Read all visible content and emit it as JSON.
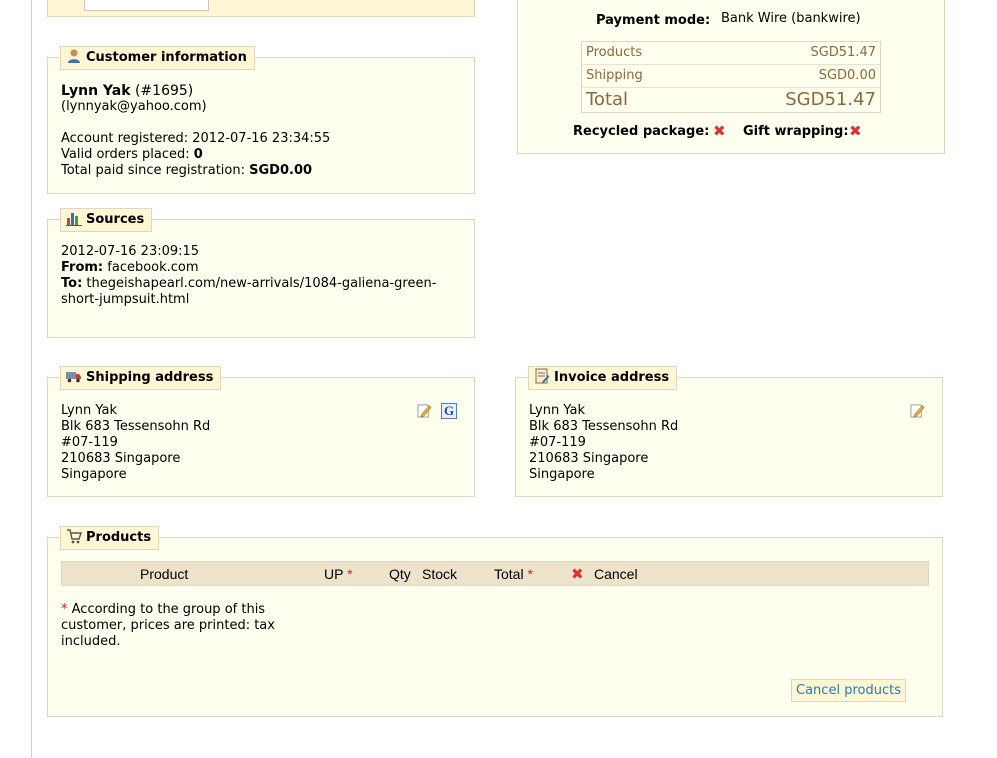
{
  "payment": {
    "mode_label": "Payment mode:",
    "mode_value": "Bank Wire (bankwire)",
    "rows": [
      {
        "label": "Products",
        "value": "SGD51.47"
      },
      {
        "label": "Shipping",
        "value": "SGD0.00"
      },
      {
        "label": "Total",
        "value": "SGD51.47"
      }
    ],
    "recycled_label": "Recycled package:",
    "gift_label": "Gift wrapping:"
  },
  "customer": {
    "legend": "Customer information",
    "name": "Lynn Yak",
    "id": "(#1695)",
    "email": "(lynnyak@yahoo.com)",
    "registered_label": "Account registered:",
    "registered_value": "2012-07-16 23:34:55",
    "orders_label": "Valid orders placed:",
    "orders_value": "0",
    "paid_label": "Total paid since registration:",
    "paid_value": "SGD0.00"
  },
  "sources": {
    "legend": "Sources",
    "date": "2012-07-16 23:09:15",
    "from_label": "From:",
    "from_value": "facebook.com",
    "to_label": "To:",
    "to_value_line1": "thegeishapearl.com/new-arrivals/1084-galiena-green-",
    "to_value_line2": "short-jumpsuit.html"
  },
  "shipping_address": {
    "legend": "Shipping address",
    "lines": [
      "Lynn Yak",
      "Blk 683 Tessensohn Rd",
      "#07-119",
      "210683 Singapore",
      "Singapore"
    ],
    "g_icon_text": "G"
  },
  "invoice_address": {
    "legend": "Invoice address",
    "lines": [
      "Lynn Yak",
      "Blk 683 Tessensohn Rd",
      "#07-119",
      "210683 Singapore",
      "Singapore"
    ]
  },
  "products": {
    "legend": "Products",
    "columns": {
      "product": "Product",
      "up": "UP",
      "qty": "Qty",
      "stock": "Stock",
      "total": "Total",
      "cancel": "Cancel"
    },
    "required_mark": "*",
    "note_line1": "According to the group of this",
    "note_line2": "customer, prices are printed: tax",
    "note_line3": "included.",
    "cancel_button": "Cancel products"
  },
  "icons": {
    "customer": "user-icon",
    "sources": "bar-chart-icon",
    "shipping": "truck-icon",
    "invoice": "invoice-icon",
    "products": "cart-icon",
    "edit": "pencil-edit-icon",
    "google_maps": "google-maps-icon",
    "cross": "red-cross-icon"
  },
  "colors": {
    "panel_bg": "#fffff0",
    "legend_bg": "#fff6d3",
    "border": "#dfd5c3",
    "table_head": "#ede3cb",
    "cross": "#e03030",
    "link": "#2a7ab0",
    "muted_brown": "#8a6a3a"
  }
}
